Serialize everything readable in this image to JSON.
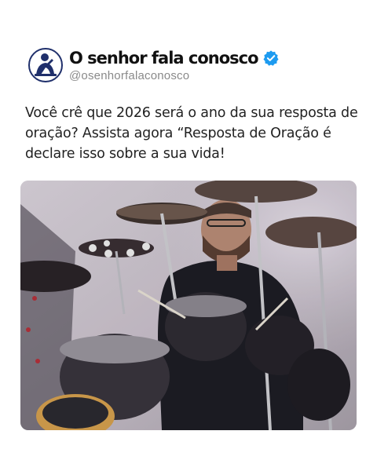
{
  "profile": {
    "display_name": "O senhor fala conosco",
    "handle": "@osenhorfalaconosco",
    "avatar_icon": "praying-man-icon",
    "verified_icon": "verified-badge-icon",
    "verified_color": "#1d9bf0"
  },
  "post": {
    "text": "Você crê que 2026 será o ano da sua resposta de oração? Assista agora “Resposta de Oração é declare isso sobre a sua vida!"
  },
  "media": {
    "subject": "drummer-photo",
    "icon": "drum-kit-photo"
  }
}
